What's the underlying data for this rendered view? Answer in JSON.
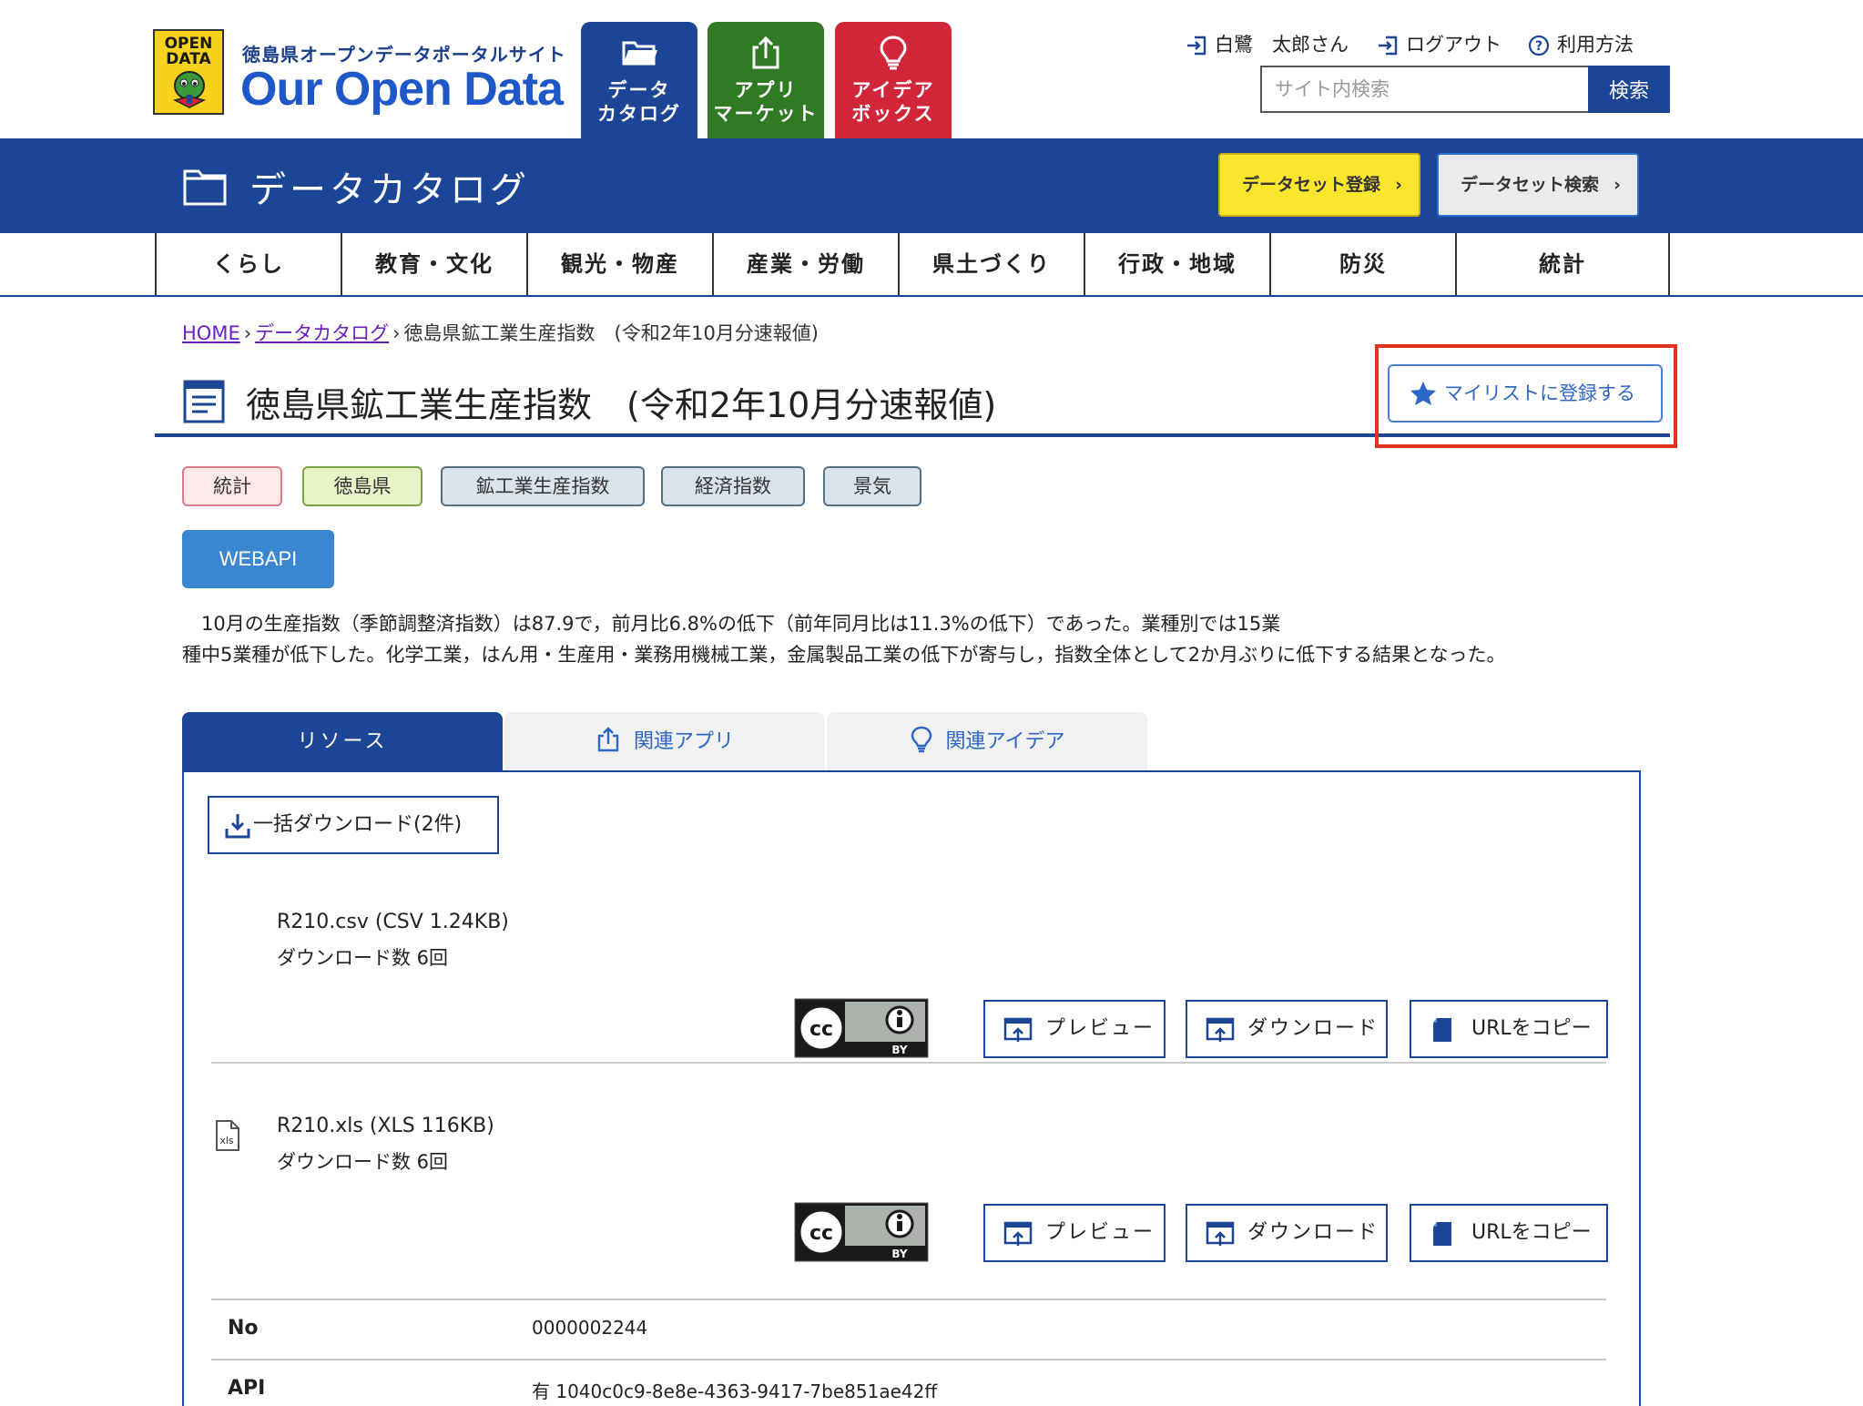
{
  "site": {
    "badge_text_1": "OPEN",
    "badge_text_2": "DATA",
    "subtitle": "徳島県オープンデータポータルサイト",
    "title": "Our Open Data"
  },
  "main_tabs": [
    {
      "label": "データ\nカタログ",
      "icon": "folder-icon",
      "color": "#1d4596"
    },
    {
      "label": "アプリ\nマーケット",
      "icon": "share-icon",
      "color": "#2f7a22"
    },
    {
      "label": "アイデア\nボックス",
      "icon": "lightbulb-icon",
      "color": "#d1263a"
    }
  ],
  "user": {
    "name": "白鷺　太郎さん",
    "logout": "ログアウト",
    "help": "利用方法"
  },
  "search": {
    "placeholder": "サイト内検索",
    "button": "検索"
  },
  "band": {
    "title": "データカタログ",
    "register_button": "データセット登録",
    "search_button": "データセット検索"
  },
  "categories": [
    "くらし",
    "教育・文化",
    "観光・物産",
    "産業・労働",
    "県土づくり",
    "行政・地域",
    "防災",
    "統計"
  ],
  "breadcrumb": {
    "home": "HOME",
    "catalog": "データカタログ",
    "current": "徳島県鉱工業生産指数　(令和2年10月分速報値)"
  },
  "page_title": "徳島県鉱工業生産指数　(令和2年10月分速報値)",
  "mylist_button": "マイリストに登録する",
  "tags": [
    "統計",
    "徳島県",
    "鉱工業生産指数",
    "経済指数",
    "景気"
  ],
  "webapi_label": "WEBAPI",
  "description": "　10月の生産指数（季節調整済指数）は87.9で，前月比6.8%の低下（前年同月比は11.3%の低下）であった。業種別では15業\n種中5業種が低下した。化学工業，はん用・生産用・業務用機械工業，金属製品工業の低下が寄与し，指数全体として2か月ぶりに低下する結果となった。",
  "resource_tabs": {
    "resources": "リソース",
    "apps": "関連アプリ",
    "ideas": "関連アイデア"
  },
  "bulk_download": "一括ダウンロード(2件)",
  "resources": [
    {
      "name": "R210.csv (CSV 1.24KB)",
      "downloads": "ダウンロード数 6回",
      "file_icon": ""
    },
    {
      "name": "R210.xls (XLS 116KB)",
      "downloads": "ダウンロード数 6回",
      "file_icon": "xls"
    }
  ],
  "resource_buttons": {
    "preview": "プレビュー",
    "download": "ダウンロード",
    "copy_url": "URLをコピー"
  },
  "license_badge": "cc-by-icon",
  "meta": [
    {
      "key": "No",
      "value": "0000002244"
    },
    {
      "key": "API",
      "value": "有 1040c0c9-8e8e-4363-9417-7be851ae42ff"
    }
  ],
  "colors": {
    "primary": "#1d4596",
    "accent_yellow": "#fbe62e",
    "highlight_red": "#e0321f",
    "link_purple": "#6a1fbf",
    "link_blue": "#2d66c6"
  }
}
